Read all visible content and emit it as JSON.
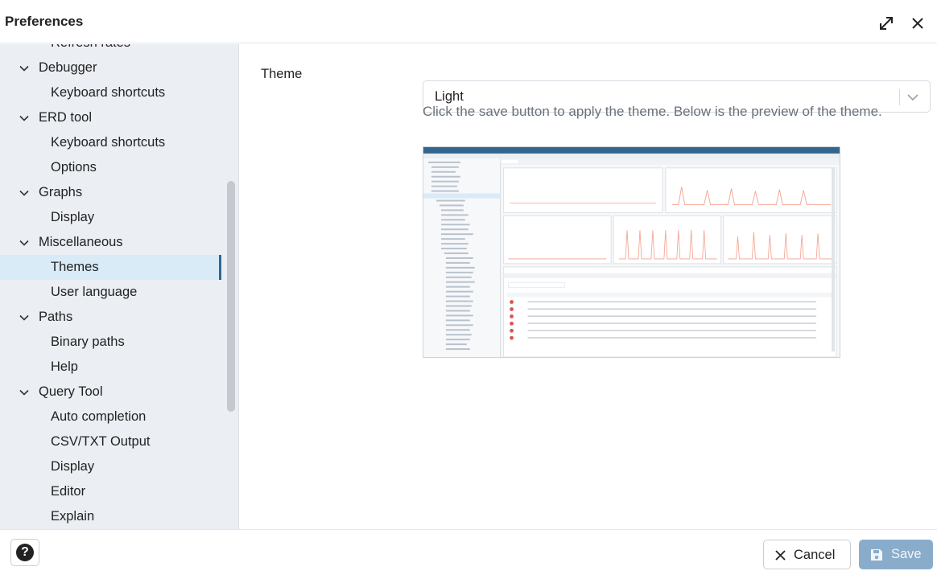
{
  "dialog": {
    "title": "Preferences"
  },
  "sidebar": {
    "items": [
      {
        "label": "Refresh rates",
        "level": "child"
      },
      {
        "label": "Debugger",
        "level": "parent"
      },
      {
        "label": "Keyboard shortcuts",
        "level": "child"
      },
      {
        "label": "ERD tool",
        "level": "parent"
      },
      {
        "label": "Keyboard shortcuts",
        "level": "child"
      },
      {
        "label": "Options",
        "level": "child"
      },
      {
        "label": "Graphs",
        "level": "parent"
      },
      {
        "label": "Display",
        "level": "child"
      },
      {
        "label": "Miscellaneous",
        "level": "parent"
      },
      {
        "label": "Themes",
        "level": "child",
        "selected": true
      },
      {
        "label": "User language",
        "level": "child"
      },
      {
        "label": "Paths",
        "level": "parent"
      },
      {
        "label": "Binary paths",
        "level": "child"
      },
      {
        "label": "Help",
        "level": "child"
      },
      {
        "label": "Query Tool",
        "level": "parent"
      },
      {
        "label": "Auto completion",
        "level": "child"
      },
      {
        "label": "CSV/TXT Output",
        "level": "child"
      },
      {
        "label": "Display",
        "level": "child"
      },
      {
        "label": "Editor",
        "level": "child"
      },
      {
        "label": "Explain",
        "level": "child"
      }
    ]
  },
  "main": {
    "theme_label": "Theme",
    "theme_value": "Light",
    "hint": "Click the save button to apply the theme. Below is the preview of the theme."
  },
  "footer": {
    "cancel_label": "Cancel",
    "save_label": "Save"
  },
  "colors": {
    "accent": "#326690",
    "selected_bg": "#d8ebf7",
    "sidebar_bg": "#ebeef3",
    "save_disabled": "#8aaccb"
  }
}
